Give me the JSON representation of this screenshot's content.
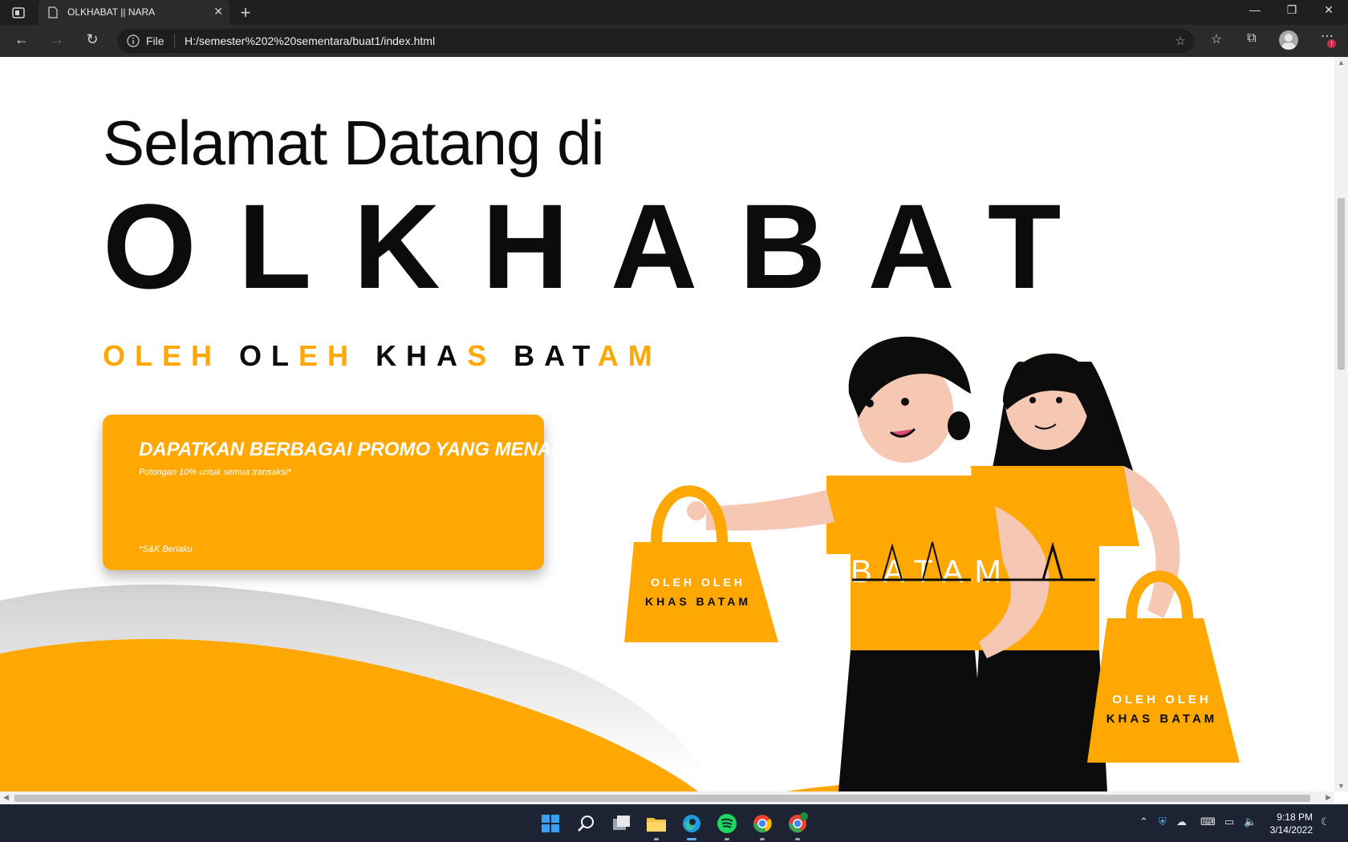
{
  "browser": {
    "tab_title": "OLKHABAT || NARA",
    "new_tab": "+",
    "address_scheme": "File",
    "url": "H:/semester%202%20sementara/buat1/index.html"
  },
  "page": {
    "heading": "Selamat Datang di",
    "brand": "OLKHABAT",
    "tagline": [
      {
        "text": "OLEH",
        "tone": "yellow"
      },
      {
        "text": " ",
        "tone": "black"
      },
      {
        "text": "OL",
        "tone": "black"
      },
      {
        "text": "EH",
        "tone": "yellow"
      },
      {
        "text": " ",
        "tone": "black"
      },
      {
        "text": "KHA",
        "tone": "black"
      },
      {
        "text": "S",
        "tone": "yellow"
      },
      {
        "text": " ",
        "tone": "black"
      },
      {
        "text": "BAT",
        "tone": "black"
      },
      {
        "text": "AM",
        "tone": "yellow"
      }
    ],
    "promo": {
      "title": "DAPATKAN BERBAGAI PROMO YANG MENARIK!",
      "subtitle": "Potongan 10% untuk semua transaksi*",
      "note": "*S&K Berlaku"
    },
    "illustration": {
      "shirt_text": "BATAM",
      "bag_line1": "OLEH OLEH",
      "bag_line2": "KHAS BATAM"
    }
  },
  "taskbar": {
    "time": "9:18 PM",
    "date": "3/14/2022"
  },
  "colors": {
    "accent": "#ffa703",
    "text_dark": "#0c0c0c",
    "browser_dark": "#2b2b2b",
    "taskbar": "#1c2433"
  }
}
